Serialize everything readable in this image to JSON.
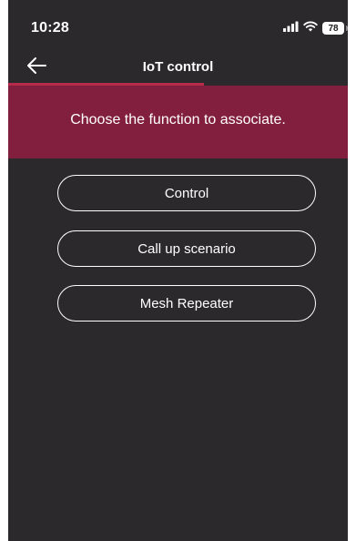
{
  "status_bar": {
    "time": "10:28",
    "battery": "78",
    "icons": [
      "cellular-signal-icon",
      "wifi-icon",
      "battery-icon"
    ]
  },
  "nav": {
    "back_icon": "arrow-left-icon",
    "title": "IoT control"
  },
  "banner": {
    "text": "Choose the function to associate."
  },
  "options": [
    {
      "label": "Control"
    },
    {
      "label": "Call up scenario"
    },
    {
      "label": "Mesh Repeater"
    }
  ],
  "colors": {
    "background": "#2b292b",
    "banner": "#821f3f",
    "accent": "#b72a4a",
    "text": "#ffffff"
  }
}
